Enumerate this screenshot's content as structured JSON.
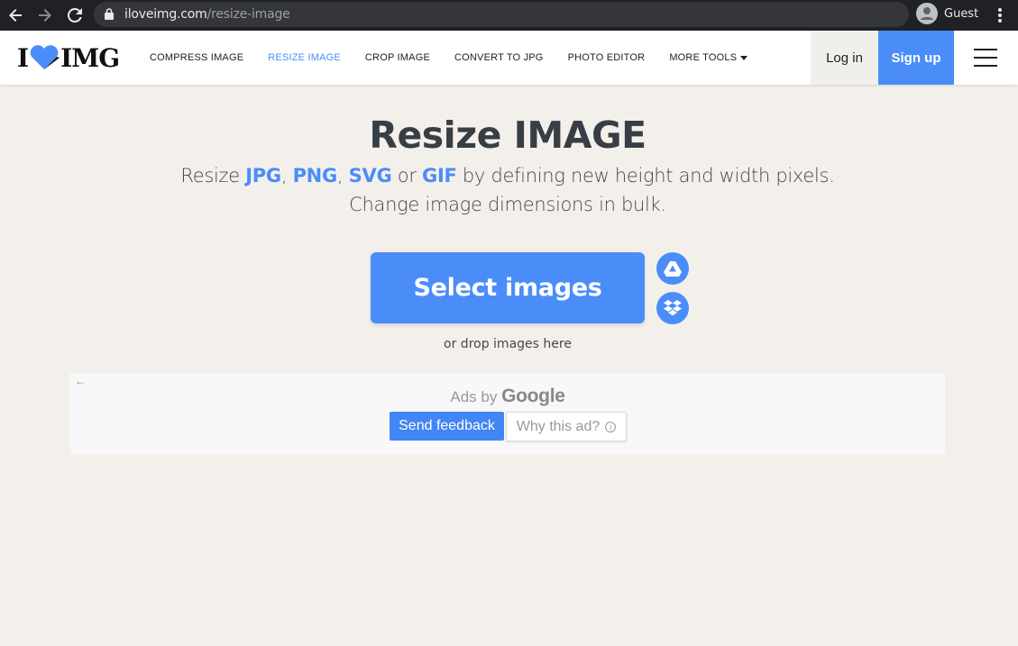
{
  "browser": {
    "url_host": "iloveimg.com",
    "url_path": "/resize-image",
    "profile_label": "Guest"
  },
  "header": {
    "logo_left": "I",
    "logo_right": "IMG",
    "nav": [
      {
        "label": "COMPRESS IMAGE",
        "active": false
      },
      {
        "label": "RESIZE IMAGE",
        "active": true
      },
      {
        "label": "CROP IMAGE",
        "active": false
      },
      {
        "label": "CONVERT TO JPG",
        "active": false
      },
      {
        "label": "PHOTO EDITOR",
        "active": false
      },
      {
        "label": "MORE TOOLS",
        "active": false
      }
    ],
    "login_label": "Log in",
    "signup_label": "Sign up"
  },
  "main": {
    "title": "Resize IMAGE",
    "subtitle_prefix": "Resize ",
    "formats": [
      "JPG",
      "PNG",
      "SVG",
      "GIF"
    ],
    "sep_comma": ", ",
    "sep_or": " or ",
    "subtitle_suffix": " by defining new height and width pixels.",
    "subtitle_line2": "Change image dimensions in bulk.",
    "select_label": "Select images",
    "drop_hint": "or drop images here"
  },
  "ad": {
    "back_arrow": "←",
    "ads_by": "Ads by",
    "google": "Google",
    "feedback_label": "Send feedback",
    "why_label": "Why this ad?",
    "info_glyph": "i"
  },
  "colors": {
    "accent": "#4b8df8",
    "background": "#f3f0ec",
    "title_text": "#383e45"
  },
  "icons": [
    "back-arrow-icon",
    "forward-arrow-icon",
    "reload-icon",
    "lock-icon",
    "account-icon",
    "menu-dots-icon",
    "heart-logo-icon",
    "caret-down-icon",
    "hamburger-icon",
    "google-drive-icon",
    "dropbox-icon",
    "info-icon"
  ]
}
